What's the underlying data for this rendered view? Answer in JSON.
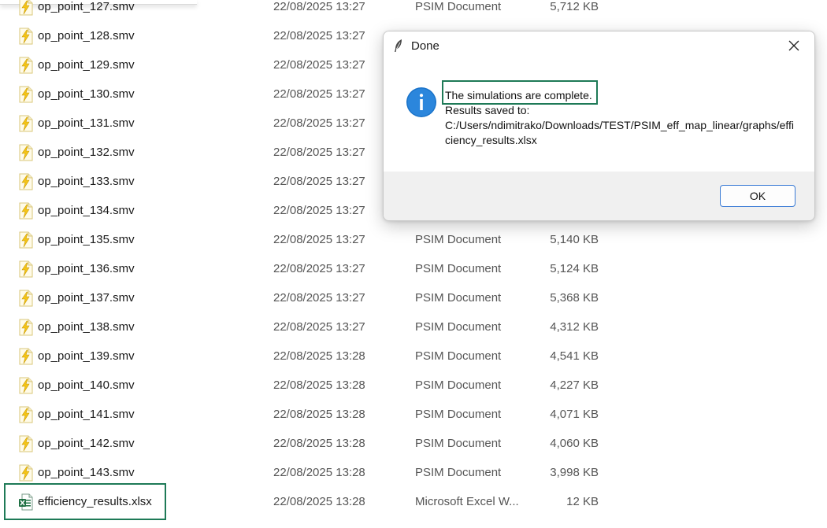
{
  "files": [
    {
      "name": "op_point_127.smv",
      "date": "22/08/2025 13:27",
      "type": "PSIM Document",
      "size": "5,712 KB",
      "icon": "psim-file-icon"
    },
    {
      "name": "op_point_128.smv",
      "date": "22/08/2025 13:27",
      "type": "",
      "size": "",
      "icon": "psim-file-icon"
    },
    {
      "name": "op_point_129.smv",
      "date": "22/08/2025 13:27",
      "type": "",
      "size": "",
      "icon": "psim-file-icon"
    },
    {
      "name": "op_point_130.smv",
      "date": "22/08/2025 13:27",
      "type": "",
      "size": "",
      "icon": "psim-file-icon"
    },
    {
      "name": "op_point_131.smv",
      "date": "22/08/2025 13:27",
      "type": "",
      "size": "",
      "icon": "psim-file-icon"
    },
    {
      "name": "op_point_132.smv",
      "date": "22/08/2025 13:27",
      "type": "",
      "size": "",
      "icon": "psim-file-icon"
    },
    {
      "name": "op_point_133.smv",
      "date": "22/08/2025 13:27",
      "type": "",
      "size": "",
      "icon": "psim-file-icon"
    },
    {
      "name": "op_point_134.smv",
      "date": "22/08/2025 13:27",
      "type": "",
      "size": "",
      "icon": "psim-file-icon"
    },
    {
      "name": "op_point_135.smv",
      "date": "22/08/2025 13:27",
      "type": "PSIM Document",
      "size": "5,140 KB",
      "icon": "psim-file-icon"
    },
    {
      "name": "op_point_136.smv",
      "date": "22/08/2025 13:27",
      "type": "PSIM Document",
      "size": "5,124 KB",
      "icon": "psim-file-icon"
    },
    {
      "name": "op_point_137.smv",
      "date": "22/08/2025 13:27",
      "type": "PSIM Document",
      "size": "5,368 KB",
      "icon": "psim-file-icon"
    },
    {
      "name": "op_point_138.smv",
      "date": "22/08/2025 13:27",
      "type": "PSIM Document",
      "size": "4,312 KB",
      "icon": "psim-file-icon"
    },
    {
      "name": "op_point_139.smv",
      "date": "22/08/2025 13:28",
      "type": "PSIM Document",
      "size": "4,541 KB",
      "icon": "psim-file-icon"
    },
    {
      "name": "op_point_140.smv",
      "date": "22/08/2025 13:28",
      "type": "PSIM Document",
      "size": "4,227 KB",
      "icon": "psim-file-icon"
    },
    {
      "name": "op_point_141.smv",
      "date": "22/08/2025 13:28",
      "type": "PSIM Document",
      "size": "4,071 KB",
      "icon": "psim-file-icon"
    },
    {
      "name": "op_point_142.smv",
      "date": "22/08/2025 13:28",
      "type": "PSIM Document",
      "size": "4,060 KB",
      "icon": "psim-file-icon"
    },
    {
      "name": "op_point_143.smv",
      "date": "22/08/2025 13:28",
      "type": "PSIM Document",
      "size": "3,998 KB",
      "icon": "psim-file-icon"
    },
    {
      "name": "efficiency_results.xlsx",
      "date": "22/08/2025 13:28",
      "type": "Microsoft Excel W...",
      "size": "12 KB",
      "icon": "excel-file-icon"
    }
  ],
  "dialog": {
    "title": "Done",
    "title_icon": "feather-icon",
    "info_icon": "info-icon",
    "message_line1": "The simulations are complete.",
    "message_line2": "Results saved to:",
    "message_line3": "C:/Users/ndimitrako/Downloads/TEST/PSIM_eff_map_linear/graphs/effi",
    "message_line4": "ciency_results.xlsx",
    "ok_label": "OK"
  },
  "colors": {
    "highlight": "#1e7a57",
    "info_blue": "#1a73c9",
    "psim_yellow": "#f5c518",
    "excel_green": "#1d6f42",
    "ok_border": "#3a7bd5"
  }
}
